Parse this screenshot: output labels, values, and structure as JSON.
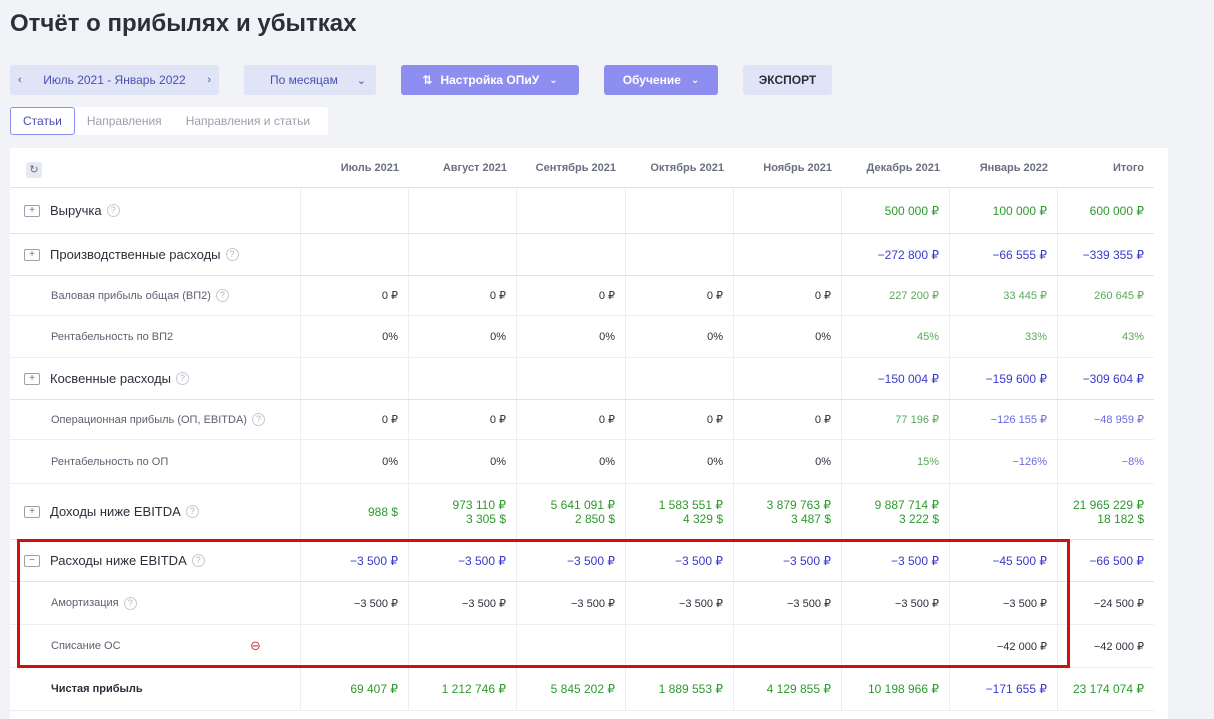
{
  "page_title": "Отчёт о прибылях и убытках",
  "toolbar": {
    "period": "Июль 2021 - Январь 2022",
    "prev_icon": "chevron-left-icon",
    "next_icon": "chevron-right-icon",
    "grouping": "По месяцам",
    "settings": "Настройка ОПиУ",
    "learning": "Обучение",
    "export": "ЭКСПОРТ"
  },
  "view_tabs": [
    "Статьи",
    "Направления",
    "Направления и статьи"
  ],
  "columns": [
    "Июль 2021",
    "Август 2021",
    "Сентябрь 2021",
    "Октябрь 2021",
    "Ноябрь 2021",
    "Декабрь 2021",
    "Январь 2022",
    "Итого"
  ],
  "rows": [
    {
      "label": "Выручка",
      "kind": "section",
      "folder": "+",
      "help": true,
      "values": [
        [
          "",
          ""
        ],
        [
          "",
          ""
        ],
        [
          "",
          ""
        ],
        [
          "",
          ""
        ],
        [
          "",
          ""
        ],
        [
          "500 000 ₽",
          ""
        ],
        [
          "100 000 ₽",
          ""
        ],
        [
          "600 000 ₽",
          ""
        ]
      ],
      "color": "g"
    },
    {
      "label": "Производственные расходы",
      "kind": "section",
      "folder": "+",
      "help": true,
      "values": [
        [
          "",
          ""
        ],
        [
          "",
          ""
        ],
        [
          "",
          ""
        ],
        [
          "",
          ""
        ],
        [
          "",
          ""
        ],
        [
          "−272 800 ₽",
          ""
        ],
        [
          "−66 555 ₽",
          ""
        ],
        [
          "−339 355 ₽",
          ""
        ]
      ],
      "color": "b"
    },
    {
      "label": "Валовая прибыль общая (ВП2)",
      "kind": "sub",
      "help": true,
      "values": [
        [
          "0 ₽",
          ""
        ],
        [
          "0 ₽",
          ""
        ],
        [
          "0 ₽",
          ""
        ],
        [
          "0 ₽",
          ""
        ],
        [
          "0 ₽",
          ""
        ],
        [
          "227 200 ₽",
          ""
        ],
        [
          "33 445 ₽",
          ""
        ],
        [
          "260 645 ₽",
          ""
        ]
      ],
      "colors": [
        "k",
        "k",
        "k",
        "k",
        "k",
        "gl",
        "gl",
        "gl"
      ]
    },
    {
      "label": "Рентабельность по ВП2",
      "kind": "sub",
      "help": false,
      "values": [
        [
          "0%",
          ""
        ],
        [
          "0%",
          ""
        ],
        [
          "0%",
          ""
        ],
        [
          "0%",
          ""
        ],
        [
          "0%",
          ""
        ],
        [
          "45%",
          ""
        ],
        [
          "33%",
          ""
        ],
        [
          "43%",
          ""
        ]
      ],
      "colors": [
        "k",
        "k",
        "k",
        "k",
        "k",
        "gl",
        "gl",
        "gl"
      ]
    },
    {
      "label": "Косвенные расходы",
      "kind": "section",
      "folder": "+",
      "help": true,
      "values": [
        [
          "",
          ""
        ],
        [
          "",
          ""
        ],
        [
          "",
          ""
        ],
        [
          "",
          ""
        ],
        [
          "",
          ""
        ],
        [
          "−150 004 ₽",
          ""
        ],
        [
          "−159 600 ₽",
          ""
        ],
        [
          "−309 604 ₽",
          ""
        ]
      ],
      "color": "b"
    },
    {
      "label": "Операционная прибыль (ОП, EBITDA)",
      "kind": "sub",
      "help": true,
      "values": [
        [
          "0 ₽",
          ""
        ],
        [
          "0 ₽",
          ""
        ],
        [
          "0 ₽",
          ""
        ],
        [
          "0 ₽",
          ""
        ],
        [
          "0 ₽",
          ""
        ],
        [
          "77 196 ₽",
          ""
        ],
        [
          "−126 155 ₽",
          ""
        ],
        [
          "−48 959 ₽",
          ""
        ]
      ],
      "colors": [
        "k",
        "k",
        "k",
        "k",
        "k",
        "gl",
        "bl",
        "bl"
      ]
    },
    {
      "label": "Рентабельность по ОП",
      "kind": "sub",
      "help": false,
      "values": [
        [
          "0%",
          ""
        ],
        [
          "0%",
          ""
        ],
        [
          "0%",
          ""
        ],
        [
          "0%",
          ""
        ],
        [
          "0%",
          ""
        ],
        [
          "15%",
          ""
        ],
        [
          "−126%",
          ""
        ],
        [
          "−8%",
          ""
        ]
      ],
      "colors": [
        "k",
        "k",
        "k",
        "k",
        "k",
        "gl",
        "bl",
        "bl"
      ]
    },
    {
      "label": "Доходы ниже EBITDA",
      "kind": "section",
      "folder": "+",
      "help": true,
      "values": [
        [
          "988 $",
          ""
        ],
        [
          "973 110 ₽",
          "3 305 $"
        ],
        [
          "5 641 091 ₽",
          "2 850 $"
        ],
        [
          "1 583 551 ₽",
          "4 329 $"
        ],
        [
          "3 879 763 ₽",
          "3 487 $"
        ],
        [
          "9 887 714 ₽",
          "3 222 $"
        ],
        [
          "",
          ""
        ],
        [
          "21 965 229 ₽",
          "18 182 $"
        ]
      ],
      "color": "g"
    },
    {
      "label": "Расходы ниже EBITDA",
      "kind": "section",
      "folder": "−",
      "help": true,
      "values": [
        [
          "−3 500 ₽",
          ""
        ],
        [
          "−3 500 ₽",
          ""
        ],
        [
          "−3 500 ₽",
          ""
        ],
        [
          "−3 500 ₽",
          ""
        ],
        [
          "−3 500 ₽",
          ""
        ],
        [
          "−3 500 ₽",
          ""
        ],
        [
          "−45 500 ₽",
          ""
        ],
        [
          "−66 500 ₽",
          ""
        ]
      ],
      "color": "b"
    },
    {
      "label": "Амортизация",
      "kind": "sub",
      "help": true,
      "values": [
        [
          "−3 500 ₽",
          ""
        ],
        [
          "−3 500 ₽",
          ""
        ],
        [
          "−3 500 ₽",
          ""
        ],
        [
          "−3 500 ₽",
          ""
        ],
        [
          "−3 500 ₽",
          ""
        ],
        [
          "−3 500 ₽",
          ""
        ],
        [
          "−3 500 ₽",
          ""
        ],
        [
          "−24 500 ₽",
          ""
        ]
      ],
      "colors": [
        "k",
        "k",
        "k",
        "k",
        "k",
        "k",
        "k",
        "k"
      ]
    },
    {
      "label": "Списание ОС",
      "kind": "sub",
      "help": false,
      "link": true,
      "values": [
        [
          "",
          ""
        ],
        [
          "",
          ""
        ],
        [
          "",
          ""
        ],
        [
          "",
          ""
        ],
        [
          "",
          ""
        ],
        [
          "",
          ""
        ],
        [
          "−42 000 ₽",
          ""
        ],
        [
          "−42 000 ₽",
          ""
        ]
      ],
      "colors": [
        "k",
        "k",
        "k",
        "k",
        "k",
        "k",
        "k",
        "k"
      ]
    },
    {
      "label": "Чистая прибыль",
      "kind": "bold",
      "help": false,
      "values": [
        [
          "69 407 ₽",
          ""
        ],
        [
          "1 212 746 ₽",
          ""
        ],
        [
          "5 845 202 ₽",
          ""
        ],
        [
          "1 889 553 ₽",
          ""
        ],
        [
          "4 129 855 ₽",
          ""
        ],
        [
          "10 198 966 ₽",
          ""
        ],
        [
          "−171 655 ₽",
          ""
        ],
        [
          "23 174 074 ₽",
          ""
        ]
      ],
      "colors": [
        "g",
        "g",
        "g",
        "g",
        "g",
        "g",
        "b",
        "g"
      ]
    }
  ],
  "icons": {
    "refresh": "refresh-icon",
    "link": "link-icon",
    "help": "help-icon",
    "folder": "folder-icon"
  }
}
